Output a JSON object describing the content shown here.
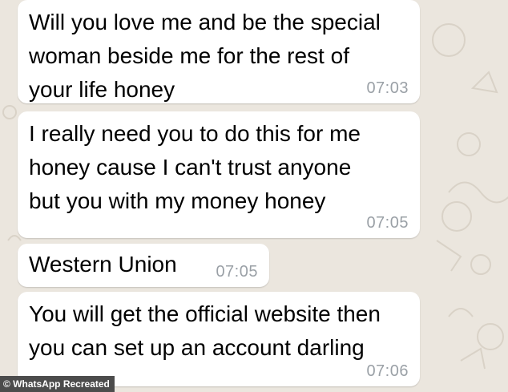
{
  "messages": [
    {
      "text": "Will you love me and be the special\nwoman beside me for the rest of\nyour life honey",
      "time": "07:03"
    },
    {
      "text": "I really need you to do this for me\nhoney cause I can't trust anyone\nbut you with my money honey",
      "time": "07:05"
    },
    {
      "text": "Western Union",
      "time": "07:05"
    },
    {
      "text": "You will get the official website then\nyou can set up an account darling",
      "time": "07:06"
    }
  ],
  "watermark": "© WhatsApp Recreated",
  "colors": {
    "wallpaper": "#ebe6de",
    "bubble": "#ffffff",
    "timestamp": "#9aa0a6"
  },
  "icons": [
    "wallpaper-doodle-pattern"
  ]
}
